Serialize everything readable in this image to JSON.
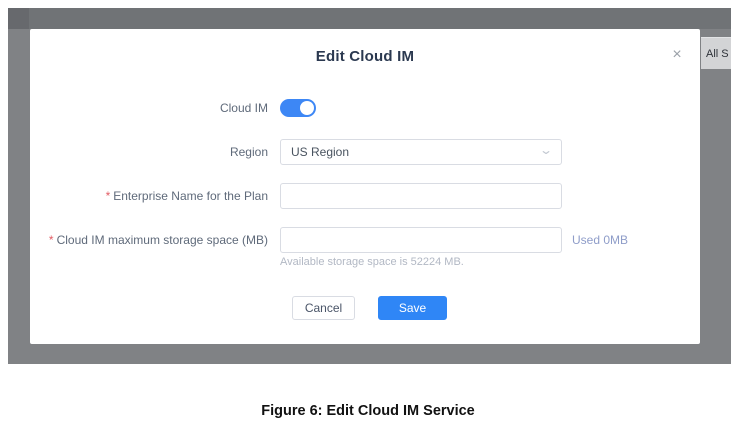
{
  "background": {
    "right_band_text": "All S"
  },
  "modal": {
    "title": "Edit Cloud IM",
    "fields": {
      "cloud_im": {
        "label": "Cloud IM",
        "enabled": true
      },
      "region": {
        "label": "Region",
        "value": "US Region"
      },
      "enterprise_name": {
        "required_marker": "*",
        "label": "Enterprise Name for the Plan",
        "value": "",
        "placeholder": ""
      },
      "storage": {
        "required_marker": "*",
        "label": "Cloud IM maximum storage space (MB)",
        "value": "",
        "placeholder": "",
        "used_text": "Used 0MB",
        "helper_text": "Available storage space is 52224 MB."
      }
    },
    "buttons": {
      "cancel": "Cancel",
      "save": "Save"
    }
  },
  "icons": {
    "close": "×",
    "chevron_down": "⌄"
  },
  "figure": {
    "caption": "Figure 6: Edit Cloud IM Service"
  },
  "colors": {
    "accent_blue": "#2f86f6",
    "toggle_blue": "#3d87f5",
    "backdrop_gray": "#808285",
    "required_red": "#e25c64",
    "used_text_blue": "#8f9dc9"
  }
}
